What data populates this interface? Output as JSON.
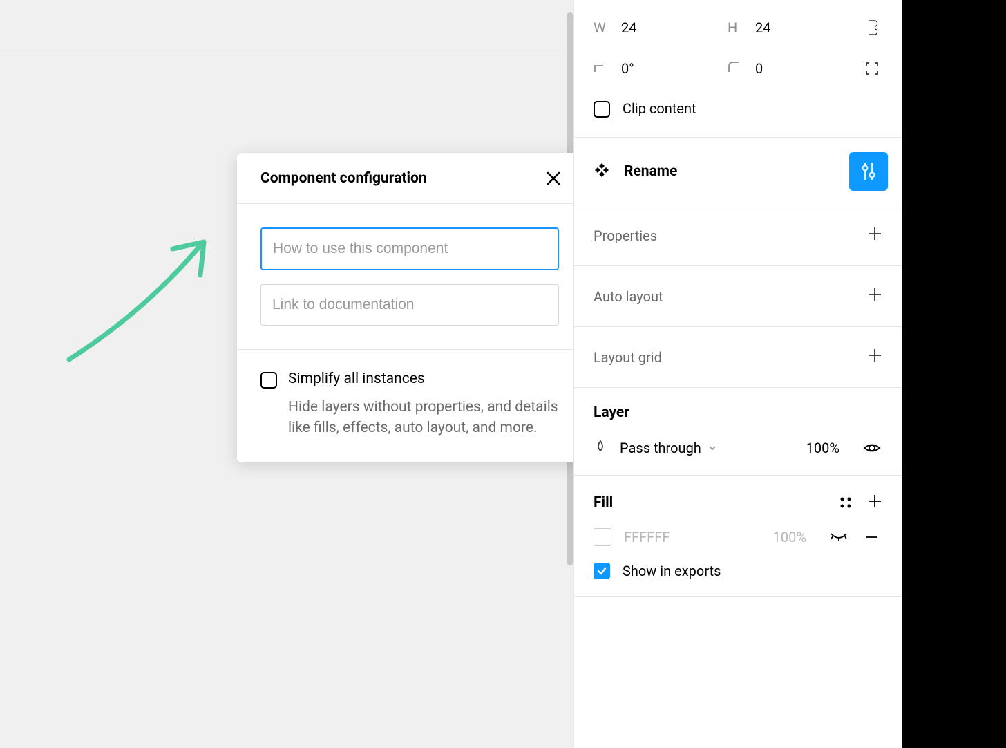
{
  "modal": {
    "title": "Component configuration",
    "input_description_placeholder": "How to use this component",
    "input_link_placeholder": "Link to documentation",
    "simplify_label": "Simplify all instances",
    "simplify_desc": "Hide layers without properties, and details like fills, effects, auto layout, and more."
  },
  "panel": {
    "dims": {
      "w_label": "W",
      "w_value": "24",
      "h_label": "H",
      "h_value": "24",
      "rotation_value": "0°",
      "radius_value": "0",
      "clip_label": "Clip content"
    },
    "rename_label": "Rename",
    "properties_label": "Properties",
    "autolayout_label": "Auto layout",
    "layoutgrid_label": "Layout grid",
    "layer": {
      "title": "Layer",
      "blend_mode": "Pass through",
      "opacity": "100%"
    },
    "fill": {
      "title": "Fill",
      "hex": "FFFFFF",
      "opacity": "100%",
      "show_in_exports": "Show in exports"
    }
  }
}
